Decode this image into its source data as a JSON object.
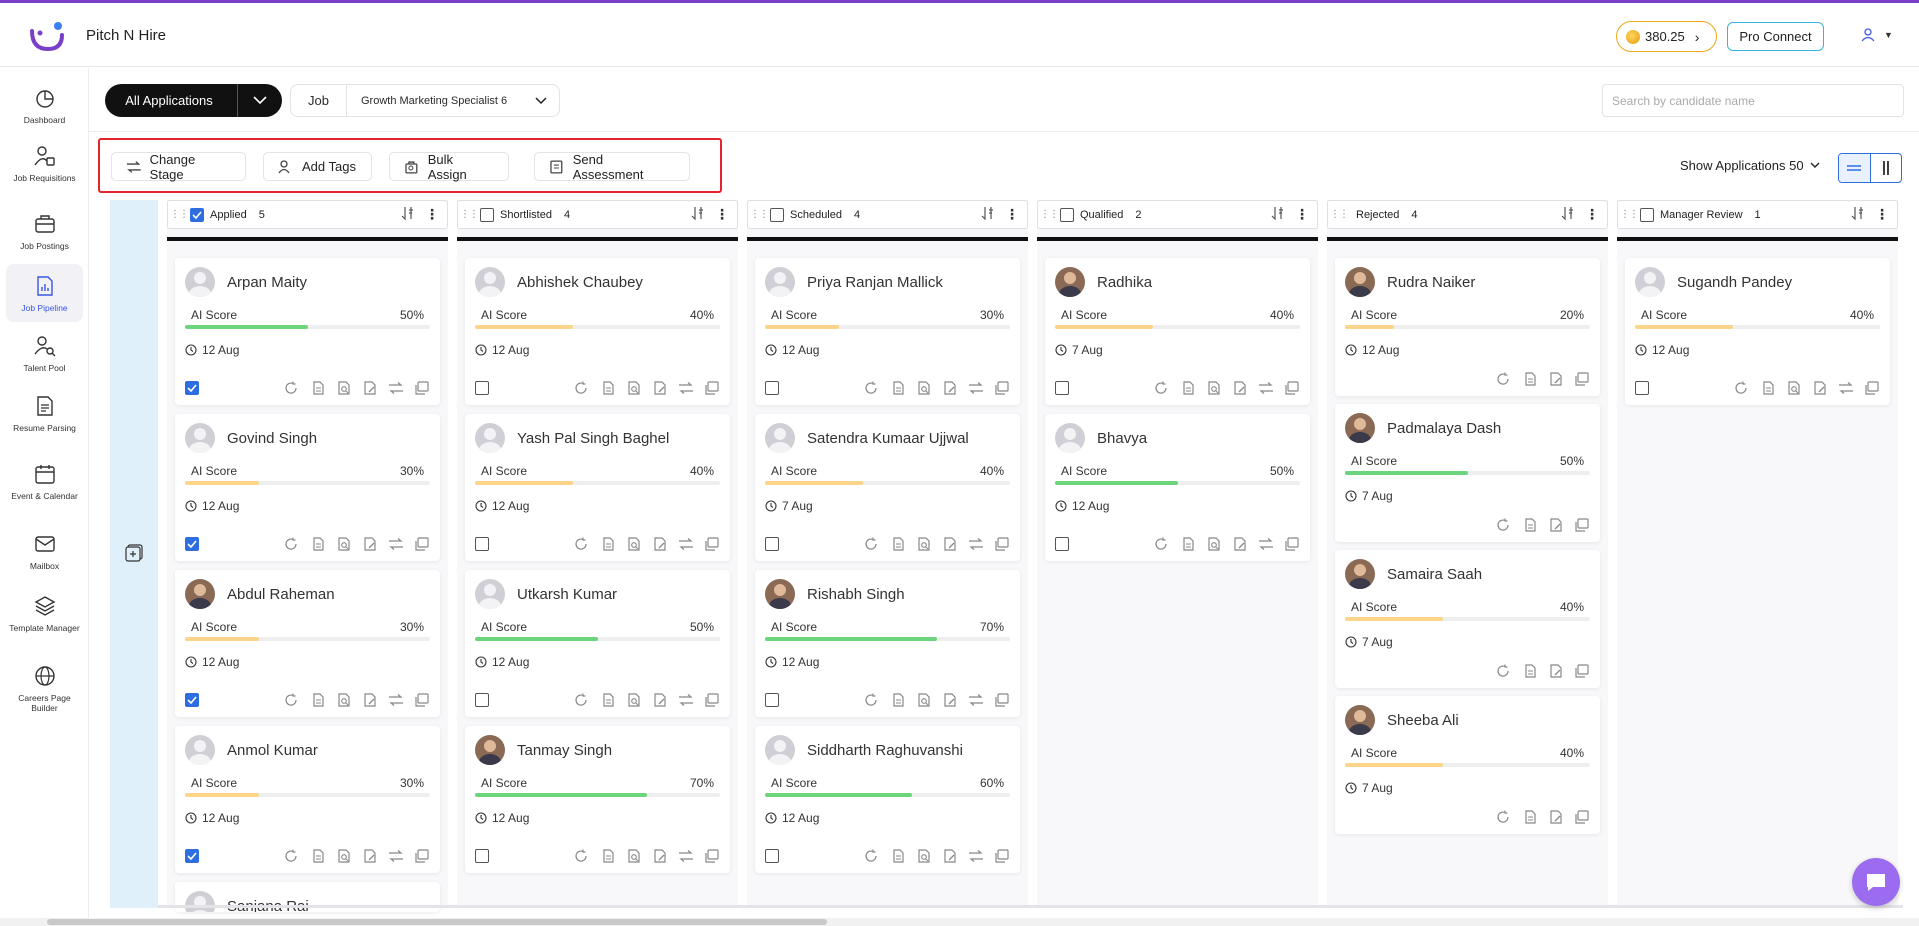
{
  "app": {
    "brand": "Pitch N Hire",
    "coins": "380.25",
    "pro_connect": "Pro Connect"
  },
  "sidebar": {
    "items": [
      {
        "label": "Dashboard",
        "icon": "dashboard-icon"
      },
      {
        "label": "Job Requisitions",
        "icon": "requisition-icon"
      },
      {
        "label": "Job Postings",
        "icon": "briefcase-icon"
      },
      {
        "label": "Job Pipeline",
        "icon": "pipeline-icon",
        "active": true
      },
      {
        "label": "Talent Pool",
        "icon": "talent-search-icon"
      },
      {
        "label": "Resume Parsing",
        "icon": "resume-icon"
      },
      {
        "label": "Event & Calendar",
        "icon": "calendar-icon"
      },
      {
        "label": "Mailbox",
        "icon": "mail-icon"
      },
      {
        "label": "Template Manager",
        "icon": "layers-icon"
      },
      {
        "label": "Careers Page Builder",
        "icon": "globe-icon"
      }
    ]
  },
  "filters": {
    "view_label": "All Applications",
    "job_label": "Job",
    "job_value": "Growth Marketing Specialist 6",
    "search_placeholder": "Search by candidate name"
  },
  "actions": {
    "change_stage": "Change Stage",
    "add_tags": "Add Tags",
    "bulk_assign": "Bulk Assign",
    "send_assessment": "Send Assessment",
    "show_applications": "Show Applications 50"
  },
  "colors": {
    "accent": "#2f6ee0",
    "highlight_box": "#e3242b",
    "score_high": "#6dd47e",
    "score_low": "#fcd58a"
  },
  "score_label": "AI Score",
  "columns": [
    {
      "title": "Applied",
      "count": "5",
      "has_checkbox": true,
      "checked": true,
      "cards": [
        {
          "name": "Arpan Maity",
          "score": "50%",
          "level": 0.5,
          "date": "12 Aug",
          "checked": true
        },
        {
          "name": "Govind Singh",
          "score": "30%",
          "level": 0.3,
          "date": "12 Aug",
          "checked": true
        },
        {
          "name": "Abdul Raheman",
          "score": "30%",
          "level": 0.3,
          "date": "12 Aug",
          "checked": true,
          "photo": true
        },
        {
          "name": "Anmol Kumar",
          "score": "30%",
          "level": 0.3,
          "date": "12 Aug",
          "checked": true
        }
      ]
    },
    {
      "title": "Shortlisted",
      "count": "4",
      "has_checkbox": true,
      "checked": false,
      "cards": [
        {
          "name": "Abhishek Chaubey",
          "score": "40%",
          "level": 0.4,
          "date": "12 Aug",
          "checked": false
        },
        {
          "name": "Yash Pal Singh Baghel",
          "score": "40%",
          "level": 0.4,
          "date": "12 Aug",
          "checked": false
        },
        {
          "name": "Utkarsh Kumar",
          "score": "50%",
          "level": 0.5,
          "date": "12 Aug",
          "checked": false
        },
        {
          "name": "Tanmay Singh",
          "score": "70%",
          "level": 0.7,
          "date": "12 Aug",
          "checked": false,
          "photo": true
        }
      ]
    },
    {
      "title": "Scheduled",
      "count": "4",
      "has_checkbox": true,
      "checked": false,
      "cards": [
        {
          "name": "Priya Ranjan Mallick",
          "score": "30%",
          "level": 0.3,
          "date": "12 Aug",
          "checked": false
        },
        {
          "name": "Satendra Kumaar Ujjwal",
          "score": "40%",
          "level": 0.4,
          "date": "7 Aug",
          "checked": false
        },
        {
          "name": "Rishabh Singh",
          "score": "70%",
          "level": 0.7,
          "date": "12 Aug",
          "checked": false,
          "photo": true
        },
        {
          "name": "Siddharth Raghuvanshi",
          "score": "60%",
          "level": 0.6,
          "date": "12 Aug",
          "checked": false
        }
      ]
    },
    {
      "title": "Qualified",
      "count": "2",
      "has_checkbox": true,
      "checked": false,
      "cards": [
        {
          "name": "Radhika",
          "score": "40%",
          "level": 0.4,
          "date": "7 Aug",
          "checked": false,
          "photo": true
        },
        {
          "name": "Bhavya",
          "score": "50%",
          "level": 0.5,
          "date": "12 Aug",
          "checked": false
        }
      ]
    },
    {
      "title": "Rejected",
      "count": "4",
      "has_checkbox": false,
      "checked": false,
      "cards": [
        {
          "name": "Rudra Naiker",
          "score": "20%",
          "level": 0.2,
          "date": "12 Aug",
          "photo": true
        },
        {
          "name": "Padmalaya Dash",
          "score": "50%",
          "level": 0.5,
          "date": "7 Aug",
          "photo": true
        },
        {
          "name": "Samaira Saah",
          "score": "40%",
          "level": 0.4,
          "date": "7 Aug",
          "photo": true
        },
        {
          "name": "Sheeba Ali",
          "score": "40%",
          "level": 0.4,
          "date": "7 Aug",
          "photo": true
        }
      ]
    },
    {
      "title": "Manager Review",
      "count": "1",
      "has_checkbox": true,
      "checked": false,
      "cards": [
        {
          "name": "Sugandh Pandey",
          "score": "40%",
          "level": 0.4,
          "date": "12 Aug",
          "checked": false
        }
      ]
    }
  ],
  "partial_card_name": "Sanjana Rai"
}
